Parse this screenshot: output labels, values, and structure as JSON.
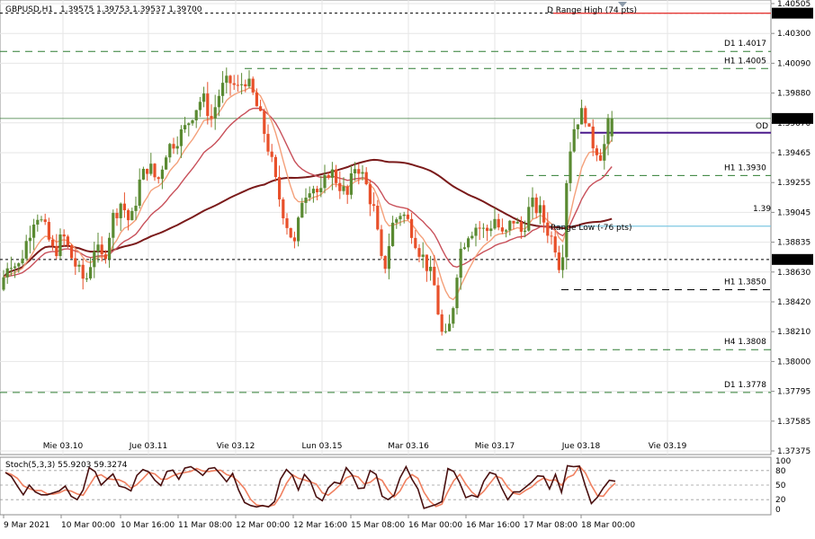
{
  "header": {
    "symbol": "GBPUSD,H1",
    "ohlc": "1.39575 1.39753 1.39537 1.39700"
  },
  "stoch_header": "Stoch(5,3,3) 55.9203 59.3274",
  "colors": {
    "bull": "#5a8a32",
    "bear": "#e8502a",
    "ma_fast": "#f4a07a",
    "ma_mid": "#c8505a",
    "ma_slow": "#7a1a1a",
    "level_green": "#2e7d32",
    "level_black": "#000000",
    "level_red": "#e53935",
    "current_price": "#3a7a3a",
    "open_purple": "#4b1a8c",
    "range_low_blue": "#7ec8e3",
    "stoch_main": "#4a1010",
    "stoch_signal": "#f08060"
  },
  "chart_data": [
    {
      "type": "candlestick",
      "price_axis": {
        "ylim": [
          1.3737,
          1.40505
        ],
        "tick_labels": [
          "1.40505",
          "1.40300",
          "1.40090",
          "1.39880",
          "1.39670",
          "1.39465",
          "1.39255",
          "1.39045",
          "1.38835",
          "1.38630",
          "1.38420",
          "1.38210",
          "1.38000",
          "1.37795",
          "1.37585",
          "1.37375"
        ]
      },
      "time_axis": {
        "labels_top": [
          "Mie 03.10",
          "Jue 03.11",
          "Vie 03.12",
          "Lun 03.15",
          "Mar 03.16",
          "Mie 03.17",
          "Jue 03.18",
          "Vie 03.19"
        ],
        "labels_bottom": [
          "9 Mar 2021",
          "10 Mar 00:00",
          "10 Mar 16:00",
          "11 Mar 08:00",
          "12 Mar 00:00",
          "12 Mar 16:00",
          "15 Mar 08:00",
          "16 Mar 00:00",
          "16 Mar 16:00",
          "17 Mar 08:00",
          "18 Mar 00:00"
        ]
      },
      "close_path": [
        [
          0,
          1.385
        ],
        [
          10,
          1.3872
        ],
        [
          20,
          1.3865
        ],
        [
          30,
          1.3885
        ],
        [
          40,
          1.3905
        ],
        [
          50,
          1.3892
        ],
        [
          60,
          1.3875
        ],
        [
          70,
          1.3888
        ],
        [
          80,
          1.3872
        ],
        [
          88,
          1.3862
        ],
        [
          95,
          1.3855
        ],
        [
          105,
          1.388
        ],
        [
          115,
          1.387
        ],
        [
          125,
          1.39
        ],
        [
          135,
          1.3912
        ],
        [
          145,
          1.3895
        ],
        [
          155,
          1.3925
        ],
        [
          165,
          1.3938
        ],
        [
          175,
          1.3925
        ],
        [
          185,
          1.3948
        ],
        [
          195,
          1.3955
        ],
        [
          205,
          1.3962
        ],
        [
          215,
          1.3975
        ],
        [
          225,
          1.3985
        ],
        [
          235,
          1.397
        ],
        [
          245,
          1.399
        ],
        [
          255,
          1.3996
        ],
        [
          265,
          1.399
        ],
        [
          272,
          1.3999
        ],
        [
          282,
          1.3985
        ],
        [
          292,
          1.3965
        ],
        [
          300,
          1.3945
        ],
        [
          308,
          1.392
        ],
        [
          318,
          1.3898
        ],
        [
          328,
          1.388
        ],
        [
          336,
          1.3915
        ],
        [
          346,
          1.3925
        ],
        [
          356,
          1.3915
        ],
        [
          366,
          1.3935
        ],
        [
          376,
          1.3925
        ],
        [
          386,
          1.3915
        ],
        [
          396,
          1.394
        ],
        [
          406,
          1.3925
        ],
        [
          416,
          1.3905
        ],
        [
          426,
          1.386
        ],
        [
          436,
          1.3895
        ],
        [
          446,
          1.3905
        ],
        [
          456,
          1.3895
        ],
        [
          466,
          1.3878
        ],
        [
          476,
          1.3865
        ],
        [
          484,
          1.385
        ],
        [
          490,
          1.382
        ],
        [
          496,
          1.3815
        ],
        [
          502,
          1.383
        ],
        [
          510,
          1.3875
        ],
        [
          520,
          1.389
        ],
        [
          530,
          1.3895
        ],
        [
          540,
          1.389
        ],
        [
          550,
          1.39
        ],
        [
          560,
          1.3885
        ],
        [
          570,
          1.39
        ],
        [
          580,
          1.389
        ],
        [
          590,
          1.391
        ],
        [
          600,
          1.3905
        ],
        [
          610,
          1.389
        ],
        [
          618,
          1.388
        ],
        [
          624,
          1.386
        ],
        [
          630,
          1.393
        ],
        [
          636,
          1.396
        ],
        [
          642,
          1.397
        ],
        [
          650,
          1.3975
        ],
        [
          656,
          1.3955
        ],
        [
          662,
          1.395
        ],
        [
          668,
          1.3945
        ],
        [
          674,
          1.3955
        ],
        [
          680,
          1.3985
        ],
        [
          686,
          1.397
        ]
      ],
      "levels": [
        {
          "label": "D1 1.4017",
          "price": 1.4017,
          "style": "green-dashed",
          "x_from": 0
        },
        {
          "label": "H1 1.4005",
          "price": 1.4005,
          "style": "green-dashed",
          "x_from": 272
        },
        {
          "label": "H1 1.3930",
          "price": 1.393,
          "style": "green-dashed",
          "x_from": 585
        },
        {
          "label": "H1 1.3850",
          "price": 1.385,
          "style": "black-dashed",
          "x_from": 624
        },
        {
          "label": "H4 1.3808",
          "price": 1.3808,
          "style": "green-dashed",
          "x_from": 485
        },
        {
          "label": "D1 1.3778",
          "price": 1.3778,
          "style": "green-dashed",
          "x_from": 0
        },
        {
          "label": "",
          "price": 1.38712,
          "style": "black-dotted",
          "x_from": 0
        },
        {
          "label": "",
          "price": 1.40438,
          "style": "black-dotted",
          "x_from": 0
        }
      ],
      "annotations": [
        {
          "text": "D Range High (74 pts)",
          "price": 1.4046,
          "style": "range-high"
        },
        {
          "text": "Range Low (-76 pts)",
          "price": 1.3892,
          "style": "range-low"
        },
        {
          "text": "1.39",
          "price": 1.3907,
          "style": "faint"
        },
        {
          "text": "OD",
          "price": 1.3965,
          "style": "open"
        }
      ],
      "open_line": {
        "price": 1.396,
        "x_from": 645
      },
      "current_price": {
        "price": 1.397,
        "label": "1.39700"
      },
      "price_tags": [
        {
          "label": "1.40438",
          "price": 1.40438
        },
        {
          "label": "1.38712",
          "price": 1.38712
        }
      ]
    },
    {
      "type": "line",
      "title": "Stoch(5,3,3) 55.9203 59.3274",
      "ylim": [
        0,
        100
      ],
      "levels": [
        80,
        50,
        20
      ],
      "tick_labels": [
        "100",
        "80",
        "50",
        "20",
        "0"
      ],
      "values": [
        76,
        68,
        48,
        30,
        50,
        36,
        30,
        30,
        34,
        38,
        48,
        27,
        20,
        40,
        86,
        78,
        50,
        62,
        73,
        48,
        45,
        38,
        70,
        82,
        77,
        60,
        49,
        78,
        81,
        62,
        85,
        88,
        80,
        70,
        84,
        86,
        72,
        57,
        74,
        40,
        14,
        8,
        5,
        8,
        5,
        16,
        62,
        82,
        70,
        40,
        72,
        58,
        26,
        18,
        44,
        56,
        53,
        86,
        71,
        43,
        44,
        80,
        72,
        27,
        20,
        29,
        65,
        88,
        62,
        42,
        2,
        6,
        10,
        16,
        84,
        78,
        54,
        24,
        29,
        25,
        58,
        76,
        72,
        44,
        20,
        36,
        36,
        46,
        56,
        69,
        68,
        42,
        72,
        35,
        90,
        88,
        89,
        48,
        12,
        25,
        44,
        60,
        58
      ]
    }
  ]
}
